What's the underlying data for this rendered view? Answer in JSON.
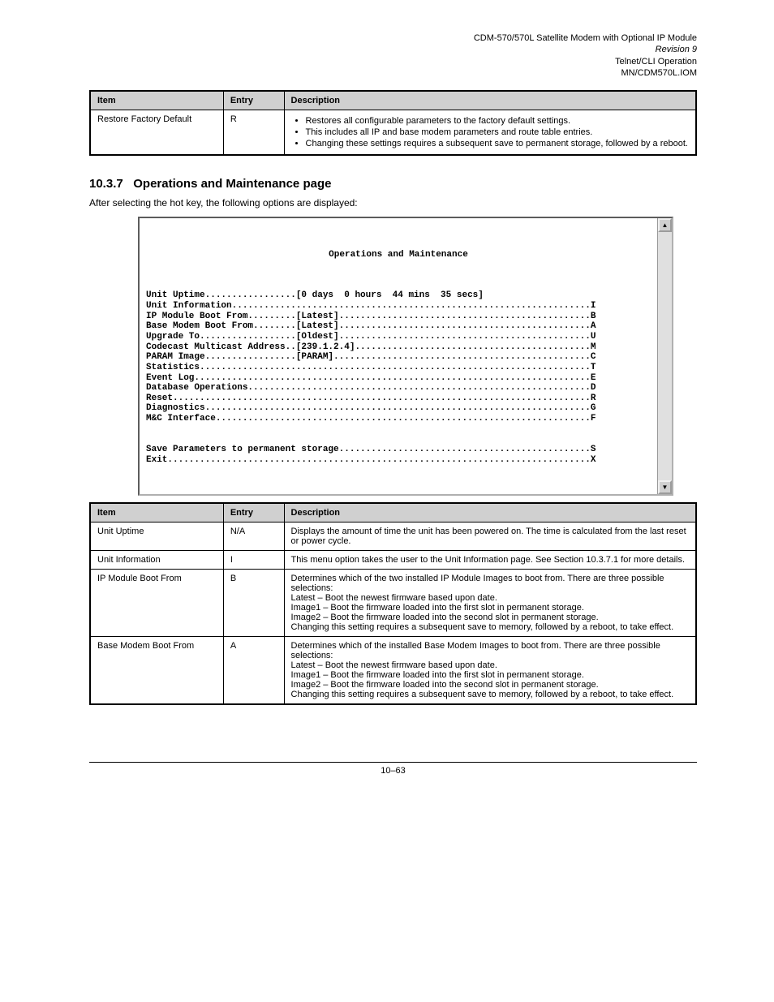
{
  "header": {
    "product": "CDM-570/570L Satellite Modem with Optional IP Module",
    "rev": "Revision 9",
    "section": "Telnet/CLI Operation",
    "doc": "MN/CDM570L.IOM"
  },
  "table1": {
    "headers": {
      "item": "Item",
      "entry": "Entry",
      "description": "Description"
    },
    "row": {
      "item": "Restore Factory Default",
      "entry": "R",
      "bullets": [
        "Restores all configurable parameters to the factory default settings.",
        "This includes all IP and base modem parameters and route table entries.",
        "Changing these settings requires a subsequent save to permanent storage, followed by a reboot."
      ]
    }
  },
  "section": {
    "number": "10.3.7",
    "title": "Operations and Maintenance page"
  },
  "after": "After selecting the hot key, the following options are displayed:",
  "terminal": {
    "title": "Operations and Maintenance",
    "lines": [
      "Unit Uptime.................[0 days  0 hours  44 mins  35 secs]",
      "Unit Information...................................................................I",
      "IP Module Boot From.........[Latest]...............................................B",
      "Base Modem Boot From........[Latest]...............................................A",
      "Upgrade To..................[Oldest]...............................................U",
      "Codecast Multicast Address..[239.1.2.4]............................................M",
      "PARAM Image.................[PARAM]................................................C",
      "Statistics.........................................................................T",
      "Event Log..........................................................................E",
      "Database Operations................................................................D",
      "Reset..............................................................................R",
      "Diagnostics........................................................................G",
      "M&C Interface......................................................................F",
      "",
      "",
      "Save Parameters to permanent storage...............................................S",
      "Exit...............................................................................X"
    ]
  },
  "table2": {
    "headers": {
      "item": "Item",
      "entry": "Entry",
      "description": "Description"
    },
    "rows": [
      {
        "item": "Unit Uptime",
        "entry": "N/A",
        "description": "Displays the amount of time the unit has been powered on. The time is calculated from the last reset or power cycle."
      },
      {
        "item": "Unit Information",
        "entry": "I",
        "description": "This menu option takes the user to the Unit Information page. See Section 10.3.7.1 for more details."
      },
      {
        "item": "IP Module Boot From",
        "entry": "B",
        "description": "Determines which of the two installed IP Module Images to boot from. There are three possible selections:\nLatest – Boot the newest firmware based upon date.\nImage1 – Boot the firmware loaded into the first slot in permanent storage.\nImage2 – Boot the firmware loaded into the second slot in permanent storage.\nChanging this setting requires a subsequent save to memory, followed by a reboot, to take effect."
      },
      {
        "item": "Base Modem Boot From",
        "entry": "A",
        "description": "Determines which of the installed Base Modem Images to boot from. There are three possible selections:\nLatest – Boot the newest firmware based upon date.\nImage1 – Boot the firmware loaded into the first slot in permanent storage.\nImage2 – Boot the firmware loaded into the second slot in permanent storage.\nChanging this setting requires a subsequent save to memory, followed by a reboot, to take effect."
      }
    ]
  },
  "footer": {
    "page": "10–63"
  }
}
